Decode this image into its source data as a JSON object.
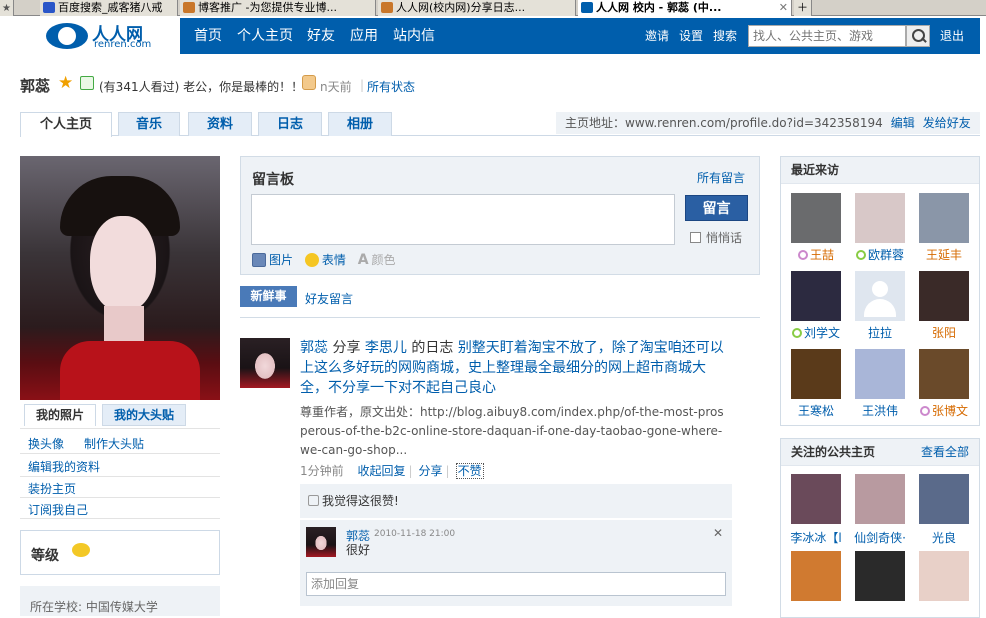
{
  "browser": {
    "tabs": [
      {
        "label": "百度搜索_戚客猪八戒"
      },
      {
        "label": "博客推广 -为您提供专业博..."
      },
      {
        "label": "人人网(校内网)分享日志..."
      },
      {
        "label": "人人网 校内 - 郭蕊 (中..."
      }
    ]
  },
  "header": {
    "logo_text": "人人网",
    "logo_domain": "renren.com",
    "nav": [
      "首页",
      "个人主页",
      "好友",
      "应用",
      "站内信"
    ],
    "right": {
      "invite": "邀请",
      "settings": "设置",
      "search": "搜索",
      "logout": "退出"
    },
    "search_placeholder": "找人、公共主页、游戏"
  },
  "profile": {
    "name": "郭蕊",
    "status": "(有341人看过) 老公，你是最棒的！！",
    "time": "n天前",
    "all_status": "所有状态"
  },
  "tabs": {
    "items": [
      "个人主页",
      "音乐",
      "资料",
      "日志",
      "相册"
    ],
    "home_address_label": "主页地址：www.renren.com/profile.do?id=342358194",
    "edit": "编辑",
    "send": "发给好友"
  },
  "left": {
    "my_photo": "我的照片",
    "my_sticker": "我的大头贴",
    "links": [
      "换头像",
      "制作大头贴",
      "编辑我的资料",
      "装扮主页",
      "订阅我自己"
    ],
    "level": "等级",
    "school": "所在学校:  中国传媒大学"
  },
  "guestbook": {
    "title": "留言板",
    "all": "所有留言",
    "submit": "留言",
    "whisper": "悄悄话",
    "tools": [
      "图片",
      "表情",
      "颜色"
    ]
  },
  "news": {
    "tab_new": "新鲜事",
    "tab_friends": "好友留言"
  },
  "feed": {
    "author": "郭蕊",
    "action": " 分享 ",
    "target": "李思儿",
    "of": " 的日志 ",
    "title": "别整天盯着淘宝不放了，除了淘宝咱还可以上这么多好玩的网购商城，史上整理最全最细分的网上超市商城大全，不分享一下对不起自己良心",
    "source": "尊重作者，原文出处：http://blog.aibuy8.com/index.php/of-the-most-prosperous-of-the-b2c-online-store-daquan-if-one-day-taobao-gone-where-we-can-go-shop...",
    "time": "1分钟前",
    "collapse": "收起回复",
    "share": "分享",
    "unlike": "不赞",
    "like_text": "我觉得这很赞!",
    "reply": {
      "name": "郭蕊",
      "time": "2010-11-18 21:00",
      "text": "很好"
    },
    "add_reply_placeholder": "添加回复"
  },
  "visitors": {
    "title": "最近来访",
    "items": [
      {
        "name": "王喆",
        "badge": "purple",
        "orange": true
      },
      {
        "name": "欧群蓉",
        "badge": "green",
        "orange": false
      },
      {
        "name": "王延丰",
        "badge": "",
        "orange": true
      },
      {
        "name": "刘学文",
        "badge": "green",
        "orange": false
      },
      {
        "name": "拉拉",
        "badge": "",
        "orange": false
      },
      {
        "name": "张阳",
        "badge": "",
        "orange": true
      },
      {
        "name": "王寒松",
        "badge": "",
        "orange": false
      },
      {
        "name": "王洪伟",
        "badge": "",
        "orange": false
      },
      {
        "name": "张博文",
        "badge": "purple",
        "orange": true
      }
    ]
  },
  "public_pages": {
    "title": "关注的公共主页",
    "all": "查看全部",
    "items": [
      "李冰冰【l",
      "仙剑奇侠·",
      "光良"
    ]
  }
}
